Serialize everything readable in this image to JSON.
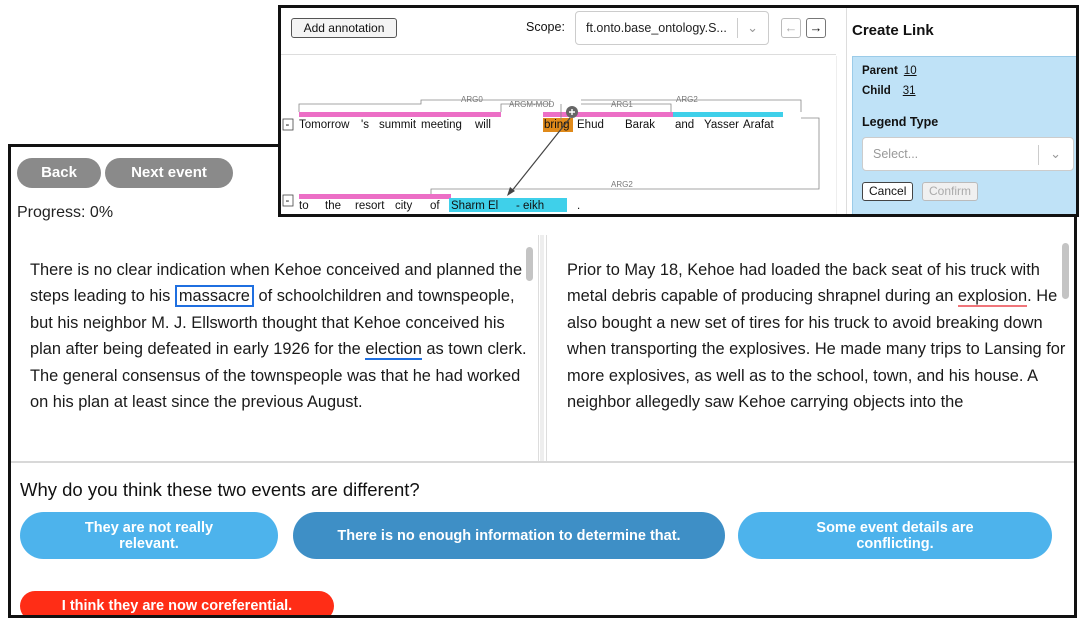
{
  "nav": {
    "back_label": "Back",
    "next_label": "Next event",
    "progress": "Progress: 0%"
  },
  "left_passage": {
    "before_massacre": "There is no clear indication when Kehoe conceived and planned the steps leading to his ",
    "massacre": "massacre",
    "after_massacre": " of schoolchildren and townspeople, but his neighbor M. J. Ellsworth thought that Kehoe conceived his plan after being defeated in early 1926 for the ",
    "election": "election",
    "after_election": " as town clerk. The general consensus of the townspeople was that he had worked on his plan at least since the previous August."
  },
  "right_passage": {
    "before_explosion": "Prior to May 18, Kehoe had loaded the back seat of his truck with metal debris capable of producing shrapnel during an ",
    "explosion": "explosion",
    "after_explosion": ". He also bought a new set of tires for his truck to avoid breaking down when transporting the explosives. He made many trips to Lansing for more explosives, as well as to the school, town, and his house. A neighbor allegedly saw Kehoe carrying objects into the"
  },
  "question": "Why do you think these two events are different?",
  "choices": {
    "not_relevant": "They are not really relevant.",
    "not_enough_info": "There is no enough information to determine that.",
    "conflicting": "Some event details are conflicting.",
    "coreferential": "I think they are now coreferential."
  },
  "annotation": {
    "add_button": "Add annotation",
    "scope_label": "Scope:",
    "scope_value": "ft.onto.base_ontology.S...",
    "prev_arrow": "←",
    "next_arrow": "→",
    "line1_tokens": [
      "Tomorrow",
      "'s",
      "summit",
      "meeting",
      "will",
      "bring",
      "Ehud",
      "Barak",
      "and",
      "Yasser",
      "Arafat"
    ],
    "line2_tokens": [
      "to",
      "the",
      "resort",
      "city",
      "of",
      "Sharm",
      "El",
      "- eikh",
      "."
    ],
    "relation_labels": {
      "arg0": "ARG0",
      "argm_mod": "ARGM-MOD",
      "arg1": "ARG1",
      "arg2_top": "ARG2",
      "arg2_bottom": "ARG2"
    },
    "collapse_marker": "-"
  },
  "create_link": {
    "title": "Create Link",
    "parent_label": "Parent",
    "parent_value": "10",
    "child_label": "Child",
    "child_value": "31",
    "legend_type_label": "Legend Type",
    "legend_placeholder": "Select...",
    "cancel_label": "Cancel",
    "confirm_label": "Confirm"
  },
  "colors": {
    "pink_span": "#ec6fc6",
    "cyan_span": "#3fd0ea",
    "orange_predicate": "#e08a1a",
    "red_choice": "#ff2d16",
    "blue_choice": "#4db3ec"
  }
}
